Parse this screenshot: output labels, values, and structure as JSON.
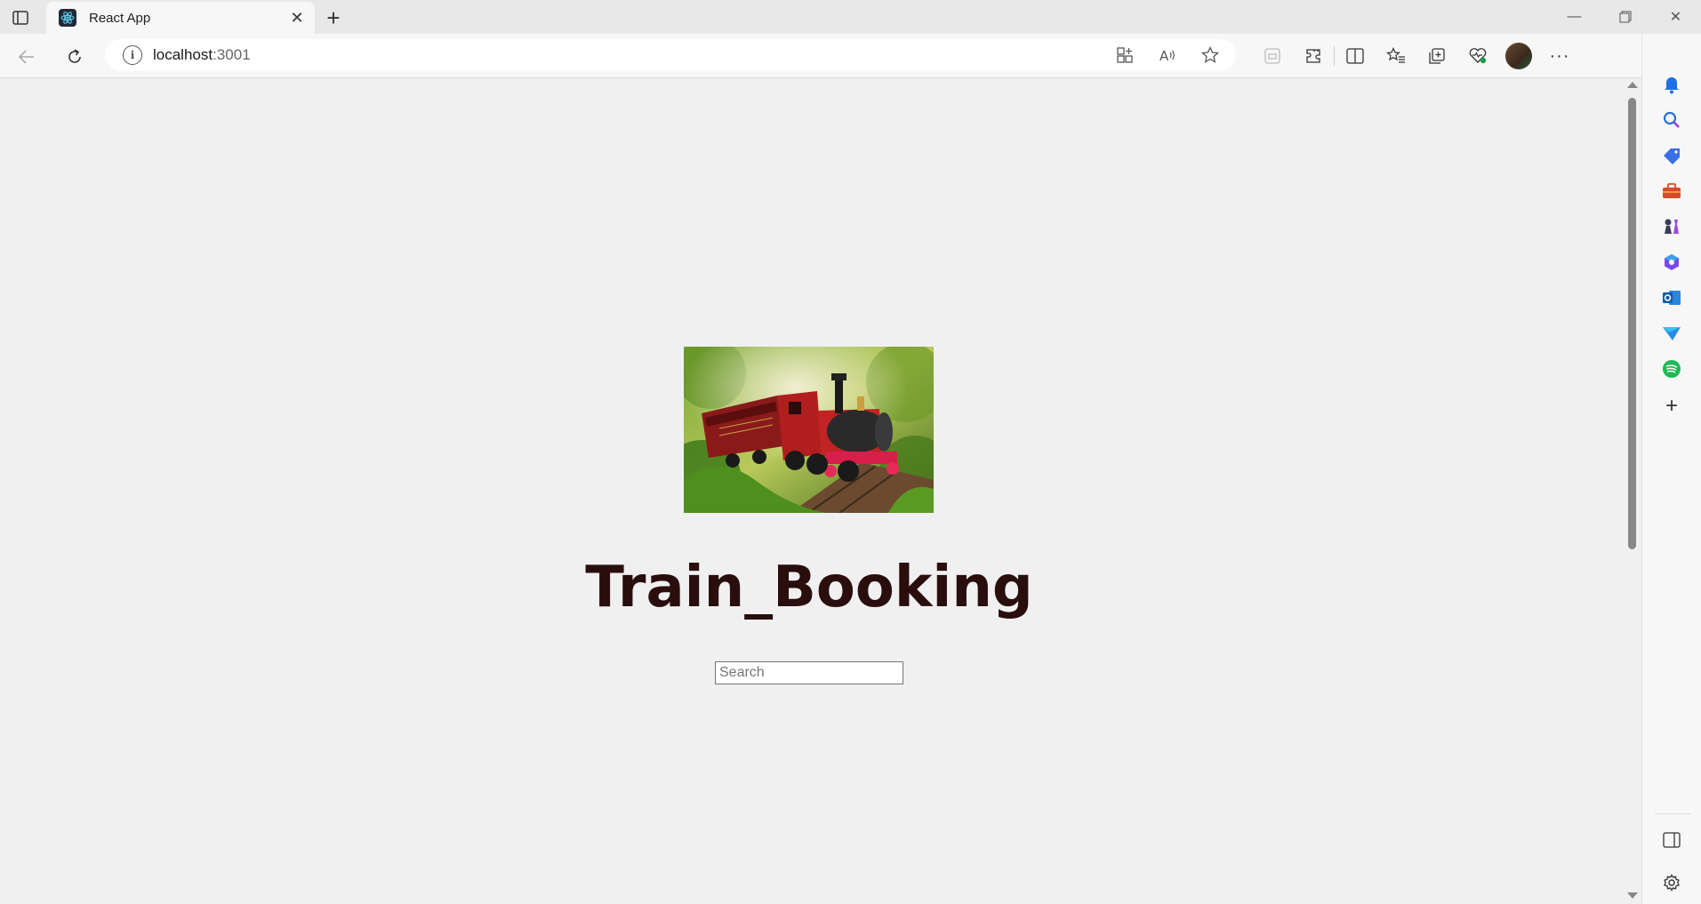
{
  "browser": {
    "tab": {
      "title": "React App"
    },
    "address": {
      "host": "localhost",
      "port": ":3001"
    }
  },
  "page": {
    "title": "Train_Booking",
    "search": {
      "placeholder": "Search",
      "value": ""
    }
  },
  "colors": {
    "page_bg": "#f0f0f0",
    "title": "#2a0d0d",
    "chrome_bg": "#f7f7f7"
  }
}
